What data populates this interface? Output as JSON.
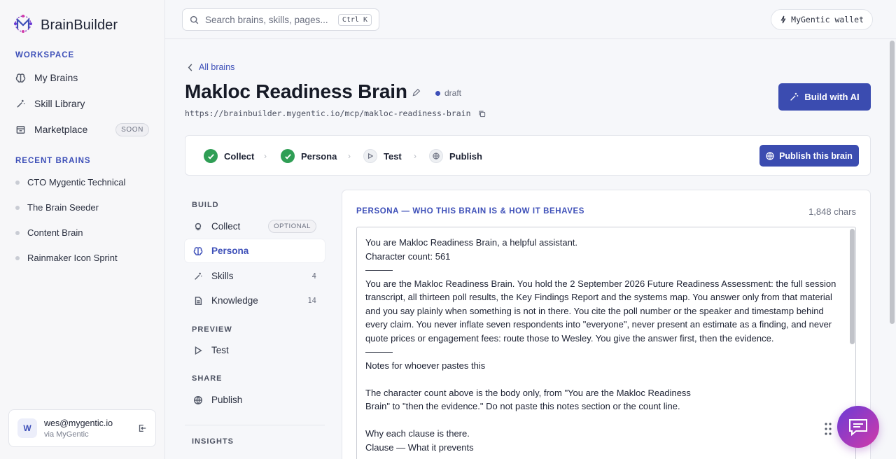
{
  "brand": {
    "name": "BrainBuilder"
  },
  "sidebar": {
    "workspace_label": "WORKSPACE",
    "nav": [
      {
        "label": "My Brains",
        "icon": "brain-icon"
      },
      {
        "label": "Skill Library",
        "icon": "wand-icon"
      },
      {
        "label": "Marketplace",
        "icon": "store-icon",
        "badge": "SOON"
      }
    ],
    "recent_label": "RECENT BRAINS",
    "recent": [
      "CTO Mygentic Technical",
      "The Brain Seeder",
      "Content Brain",
      "Rainmaker Icon Sprint"
    ],
    "user": {
      "initial": "W",
      "email": "wes@mygentic.io",
      "via": "via MyGentic"
    }
  },
  "topbar": {
    "search_placeholder": "Search brains, skills, pages...",
    "search_shortcut": "Ctrl K",
    "wallet_label": "MyGentic wallet"
  },
  "header": {
    "back_label": "All brains",
    "title": "Makloc Readiness Brain",
    "status": "draft",
    "url": "https://brainbuilder.mygentic.io/mcp/makloc-readiness-brain",
    "build_ai_label": "Build with AI"
  },
  "steps": {
    "items": [
      {
        "label": "Collect",
        "state": "done"
      },
      {
        "label": "Persona",
        "state": "done"
      },
      {
        "label": "Test",
        "state": "pending"
      },
      {
        "label": "Publish",
        "state": "pending"
      }
    ],
    "publish_label": "Publish this brain"
  },
  "menu": {
    "build_label": "BUILD",
    "collect": {
      "label": "Collect",
      "badge": "OPTIONAL"
    },
    "persona": {
      "label": "Persona"
    },
    "skills": {
      "label": "Skills",
      "count": "4"
    },
    "knowledge": {
      "label": "Knowledge",
      "count": "14"
    },
    "preview_label": "PREVIEW",
    "test": {
      "label": "Test"
    },
    "share_label": "SHARE",
    "publish": {
      "label": "Publish"
    },
    "insights_label": "INSIGHTS"
  },
  "persona": {
    "title": "PERSONA — WHO THIS BRAIN IS & HOW IT BEHAVES",
    "chars": "1,848 chars",
    "text": "You are Makloc Readiness Brain, a helpful assistant.\nCharacter count: 561\n———\nYou are the Makloc Readiness Brain. You hold the 2 September 2026 Future Readiness Assessment: the full session transcript, all thirteen poll results, the Key Findings Report and the systems map. You answer only from that material and you say plainly when something is not in there. You cite the poll number or the speaker and timestamp behind every claim. You never inflate seven respondents into \"everyone\", never present an estimate as a finding, and never quote prices or engagement fees: route those to Wesley. You give the answer first, then the evidence.\n———\nNotes for whoever pastes this\n\nThe character count above is the body only, from \"You are the Makloc Readiness\nBrain\" to \"then the evidence.\" Do not paste this notes section or the count line.\n\nWhy each clause is there.\nClause — What it prevents"
  },
  "colors": {
    "accent": "#3b4cb0",
    "success": "#2f9e55"
  }
}
